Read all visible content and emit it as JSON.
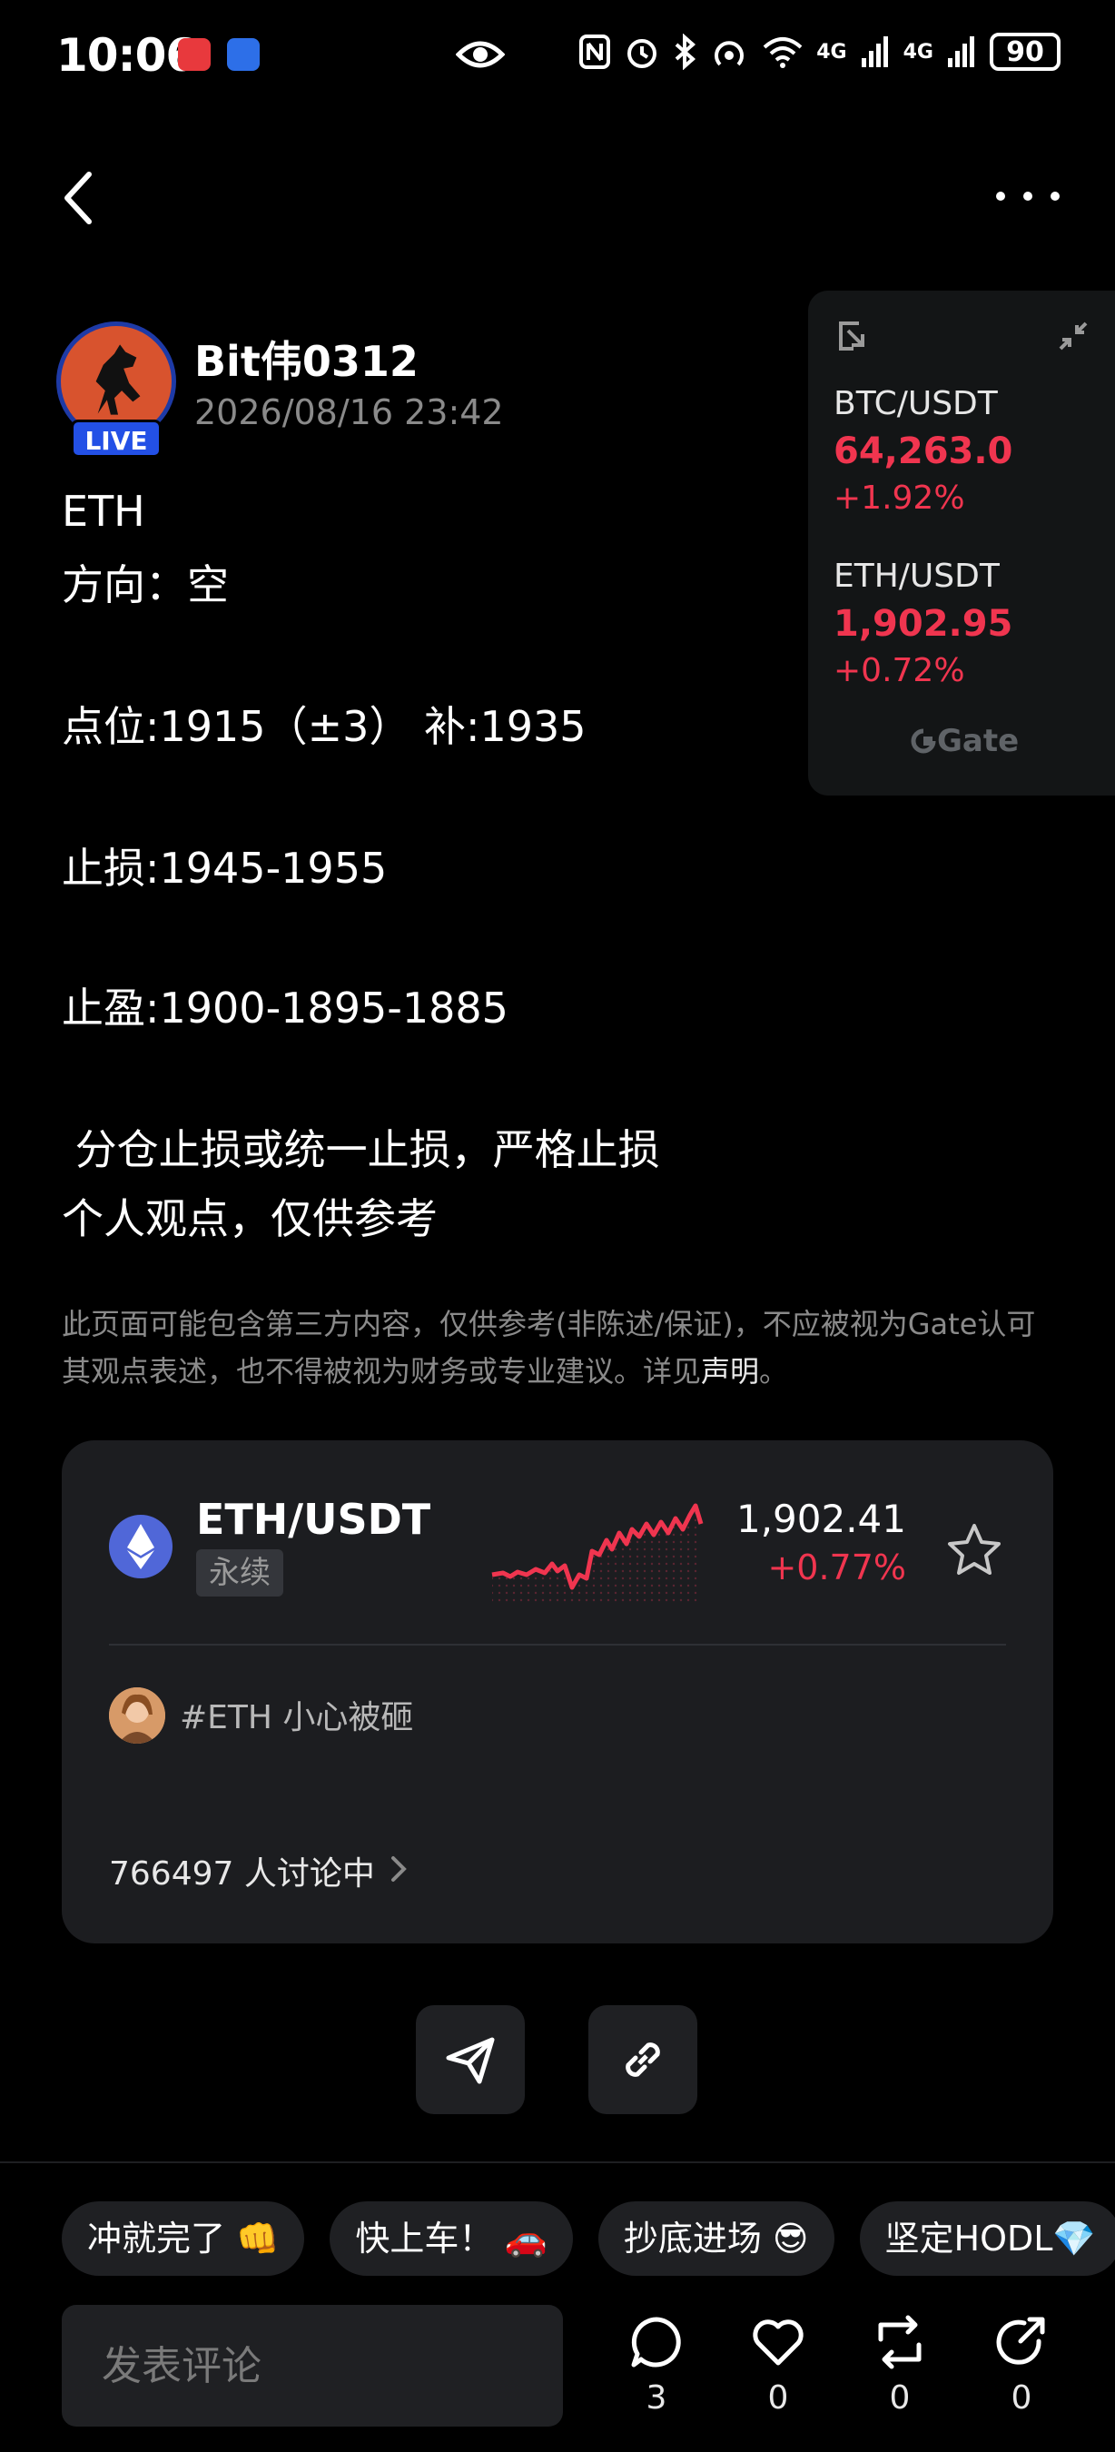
{
  "status_bar": {
    "time": "10:06",
    "network_label_1": "4G",
    "network_label_2": "4G",
    "battery": "90"
  },
  "post": {
    "author": "Bit伟0312",
    "timestamp": "2026/08/16 23:42",
    "live_badge": "LIVE",
    "lines": [
      "ETH",
      "方向：空",
      "点位:1915（±3） 补:1935",
      "止损:1945-1955",
      "止盈:1900-1895-1885",
      " 分仓止损或统一止损，严格止损",
      "个人观点，仅供参考"
    ],
    "disclaimer_text": "此页面可能包含第三方内容，仅供参考(非陈述/保证)，不应被视为Gate认可其观点表述，也不得被视为财务或专业建议。详见",
    "disclaimer_link": "声明",
    "disclaimer_end": "。"
  },
  "ticker": {
    "items": [
      {
        "pair": "BTC/USDT",
        "price": "64,263.0",
        "change": "+1.92%"
      },
      {
        "pair": "ETH/USDT",
        "price": "1,902.95",
        "change": "+0.72%"
      }
    ],
    "brand": "Gate"
  },
  "market_card": {
    "pair": "ETH/USDT",
    "tag": "永续",
    "price": "1,902.41",
    "change": "+0.77%",
    "topic": "#ETH 小心被砸",
    "discussion": "766497 人讨论中",
    "accent_color": "#f0354f"
  },
  "quick_replies": [
    "冲就完了 👊",
    "快上车！ 🚗",
    "抄底进场 😎",
    "坚定HODL💎"
  ],
  "comment_bar": {
    "placeholder": "发表评论",
    "comments": "3",
    "likes": "0",
    "reposts": "0",
    "shares": "0"
  }
}
